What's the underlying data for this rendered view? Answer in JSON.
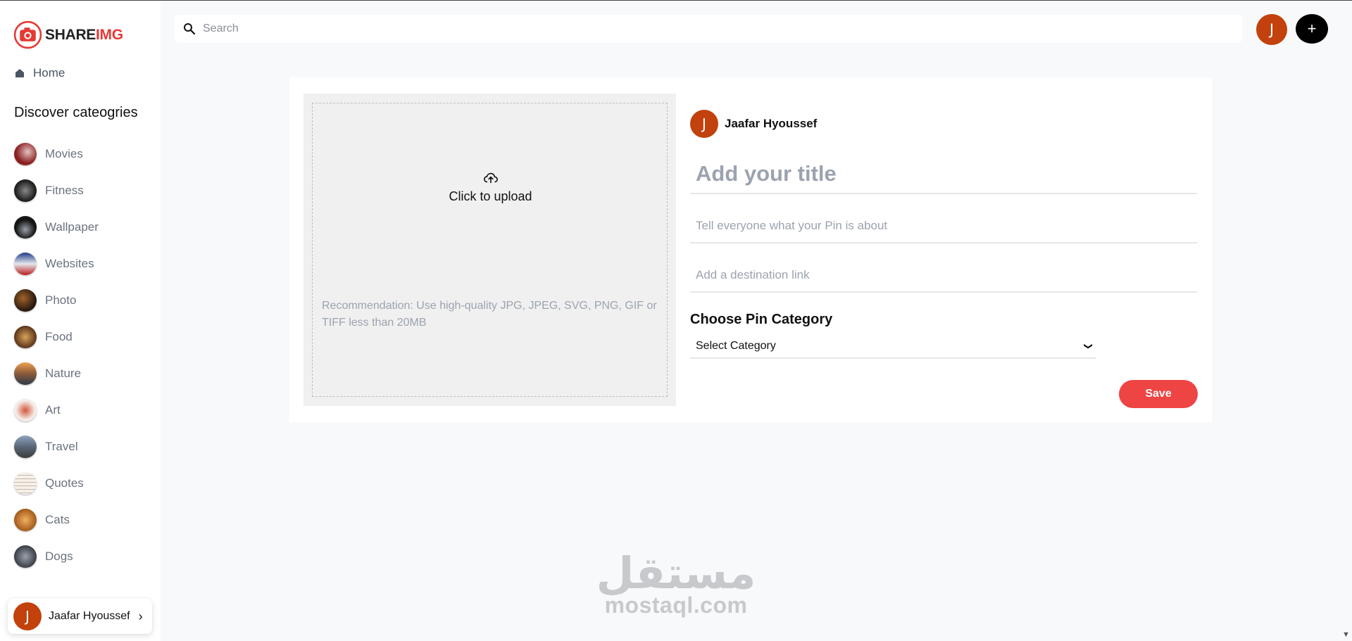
{
  "brand": {
    "part1": "SHARE",
    "part2": "IMG",
    "color": "#e53935"
  },
  "sidebar": {
    "home_label": "Home",
    "categories_title": "Discover cateogries",
    "categories": [
      {
        "label": "Movies",
        "color": "#8b1f1f"
      },
      {
        "label": "Fitness",
        "color": "#2b2b2b"
      },
      {
        "label": "Wallpaper",
        "color": "#1d1d1d"
      },
      {
        "label": "Websites",
        "color": "#1e3a8a"
      },
      {
        "label": "Photo",
        "color": "#3b2a1a"
      },
      {
        "label": "Food",
        "color": "#9a5a2a"
      },
      {
        "label": "Nature",
        "color": "#c27a3a"
      },
      {
        "label": "Art",
        "color": "#e8d8cf"
      },
      {
        "label": "Travel",
        "color": "#5a6678"
      },
      {
        "label": "Quotes",
        "color": "#efe9e2"
      },
      {
        "label": "Cats",
        "color": "#d9862f"
      },
      {
        "label": "Dogs",
        "color": "#555a66"
      }
    ],
    "user_name": "Jaafar Hyoussef",
    "user_initial": "J"
  },
  "header": {
    "search_placeholder": "Search",
    "avatar_initial": "J",
    "add_label": "+"
  },
  "upload": {
    "label": "Click to upload",
    "recommendation": "Recommendation: Use high-quality JPG, JPEG, SVG, PNG, GIF or TIFF less than 20MB"
  },
  "form": {
    "author_name": "Jaafar Hyoussef",
    "author_initial": "J",
    "title_placeholder": "Add your title",
    "about_placeholder": "Tell everyone what your Pin is about",
    "link_placeholder": "Add a destination link",
    "category_heading": "Choose Pin Category",
    "category_selected": "Select Category",
    "save_label": "Save"
  },
  "watermark": {
    "arabic": "مستقل",
    "latin": "mostaql.com"
  },
  "colors": {
    "avatar": "#c2410c",
    "save": "#ef4444"
  }
}
